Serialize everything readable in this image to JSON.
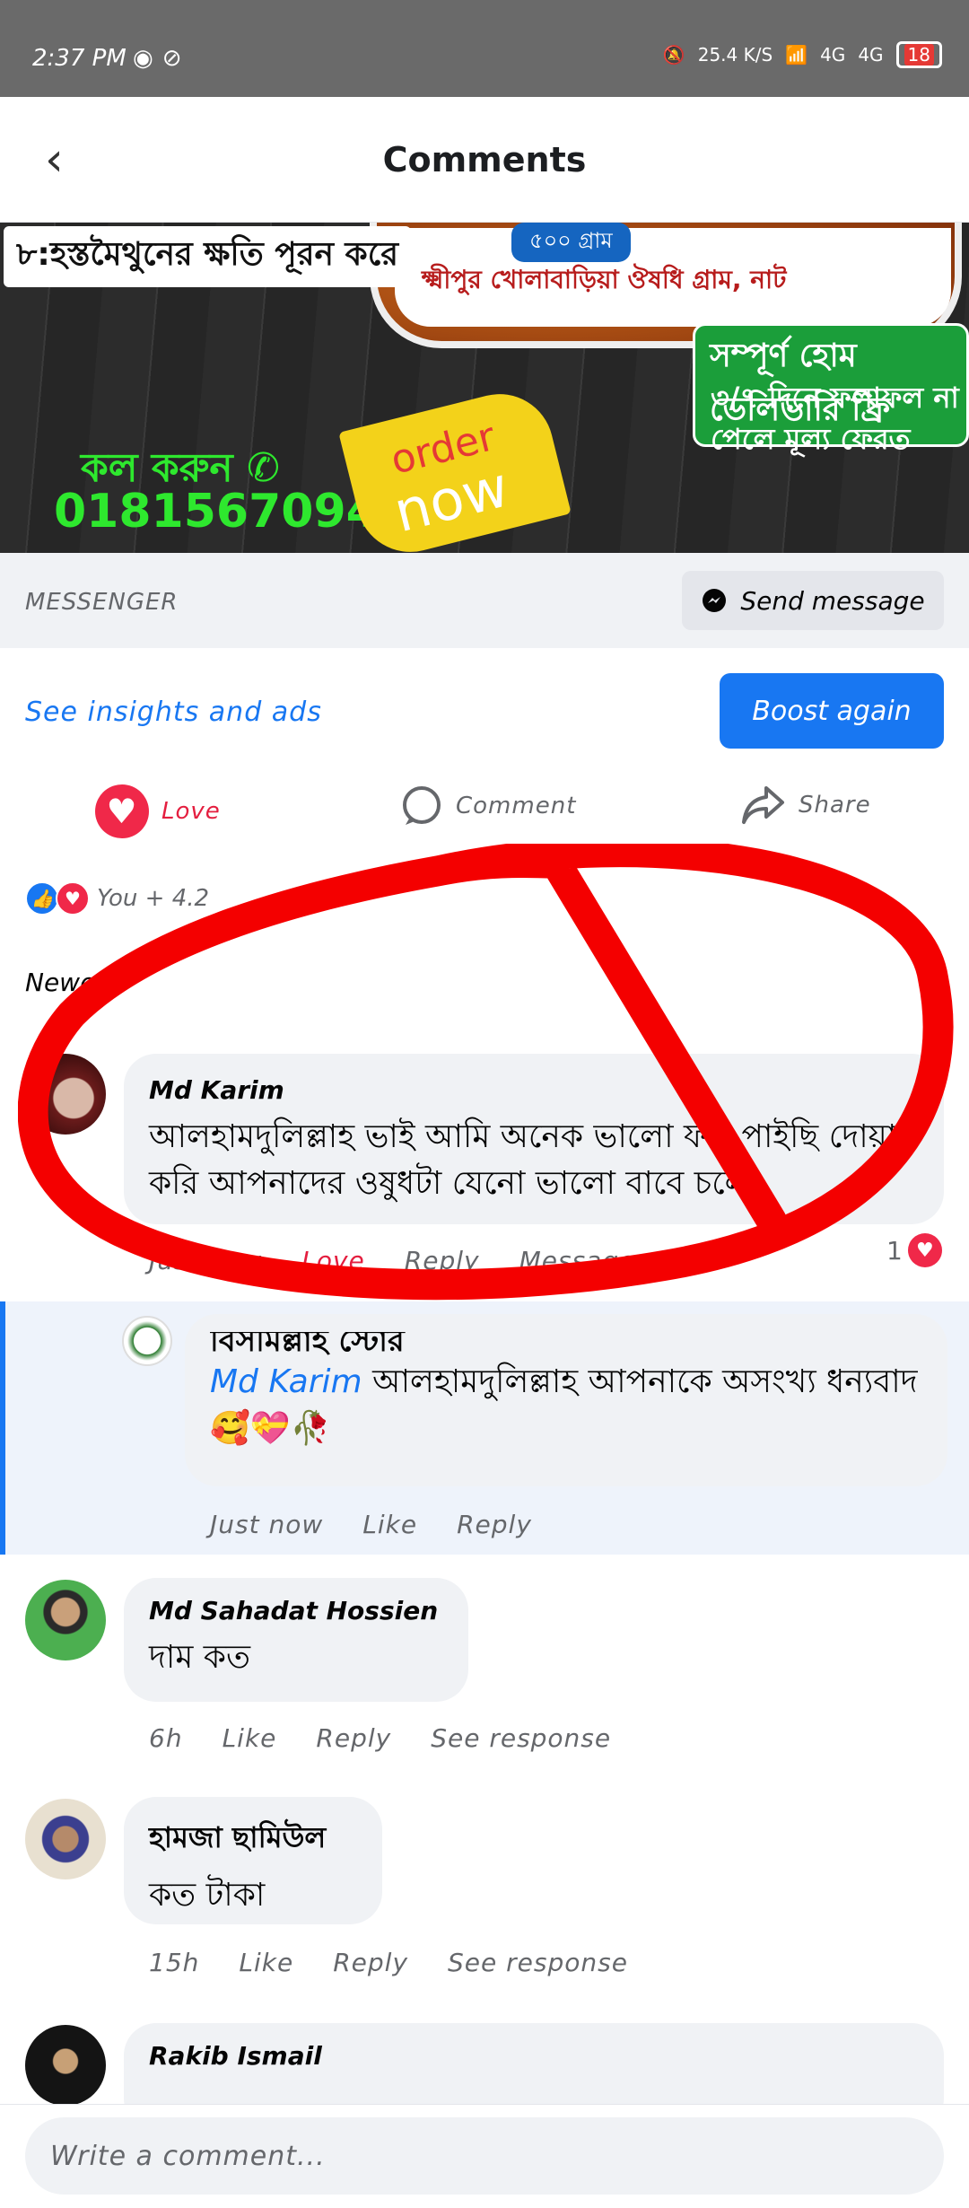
{
  "status_bar": {
    "time": "2:37 PM",
    "speed": "25.4",
    "speed_unit": "K/S",
    "net1": "4G",
    "net2": "4G",
    "battery": "18"
  },
  "header": {
    "title": "Comments"
  },
  "banner": {
    "tagline": "৮:হস্তমৈথুনের ক্ষতি পূরন করে",
    "jar_weight": "৫০০ গ্রাম",
    "jar_text": "ক্ষ্মীপুর খোলাবাড়িয়া ঔষধি গ্রাম, নাট",
    "delivery": "সম্পূর্ণ হোম ডেলিভারি ফ্রি",
    "guarantee_1": "৩/৭ দিনে ফলাফল না",
    "guarantee_2": "পেলে মূল্য ফেরত",
    "call_label": "কল করুন ✆",
    "phone": "01815670944",
    "order_1": "order",
    "order_2": "now"
  },
  "messenger": {
    "label": "MESSENGER",
    "send_label": "Send message"
  },
  "insights": {
    "link": "See insights and ads",
    "boost": "Boost again"
  },
  "actions": {
    "love": "Love",
    "comment": "Comment",
    "share": "Share"
  },
  "reactions": {
    "summary": "You + 4.2"
  },
  "sort": {
    "label": "Newest"
  },
  "comments": [
    {
      "name": "Md Karim",
      "text": "আলহামদুলিল্লাহ ভাই আমি অনেক ভালো ফল পাইছি দোয়া করি আপনাদের ওষুধটা যেনো ভালো বাবে চলে",
      "time": "Just now",
      "react": "Love",
      "reply": "Reply",
      "message": "Message",
      "count": "1"
    },
    {
      "name": "Md Sahadat Hossien",
      "text": "দাম কত",
      "time": "6h",
      "like": "Like",
      "reply": "Reply",
      "see": "See response"
    },
    {
      "name": "হামজা ছামিউল",
      "text": "কত টাকা",
      "time": "15h",
      "like": "Like",
      "reply": "Reply",
      "see": "See response"
    },
    {
      "name": "Rakib Ismail",
      "text": ""
    }
  ],
  "reply": {
    "author": "বিসমিল্লাহ স্টোর",
    "mention": "Md Karim",
    "text": " আলহামদুলিল্লাহ আপনাকে অসংখ্য ধন্যবাদ 🥰💝🥀",
    "time": "Just now",
    "like": "Like",
    "reply": "Reply"
  },
  "composer": {
    "placeholder": "Write a comment..."
  },
  "colors": {
    "accent": "#1877f2",
    "love": "#f02849",
    "annotation": "#f40000"
  }
}
